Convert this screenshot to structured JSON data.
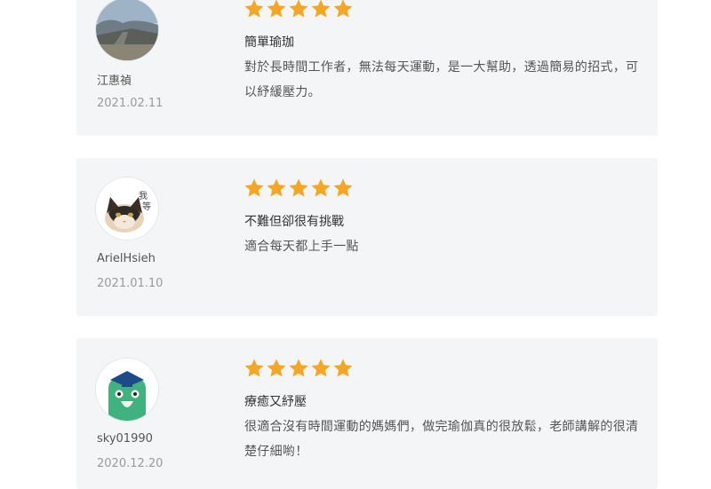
{
  "reviews": [
    {
      "reviewer": "江惠禎",
      "date": "2021.02.11",
      "rating": 5,
      "title": "簡單瑜珈",
      "text": "對於長時間工作者，無法每天運動，是一大幫助，透過簡易的招式，可以紓緩壓力。"
    },
    {
      "reviewer": "ArielHsieh",
      "date": "2021.01.10",
      "rating": 5,
      "title": "不難但卻很有挑戰",
      "text": "適合每天都上手一點"
    },
    {
      "reviewer": "sky01990",
      "date": "2020.12.20",
      "rating": 5,
      "title": "療癒又紓壓",
      "text": "很適合沒有時間運動的媽媽們，做完瑜伽真的很放鬆，老師講解的很清楚仔細喲！"
    }
  ],
  "colors": {
    "star": "#f5a623",
    "card_background": "#f3f5f6"
  }
}
